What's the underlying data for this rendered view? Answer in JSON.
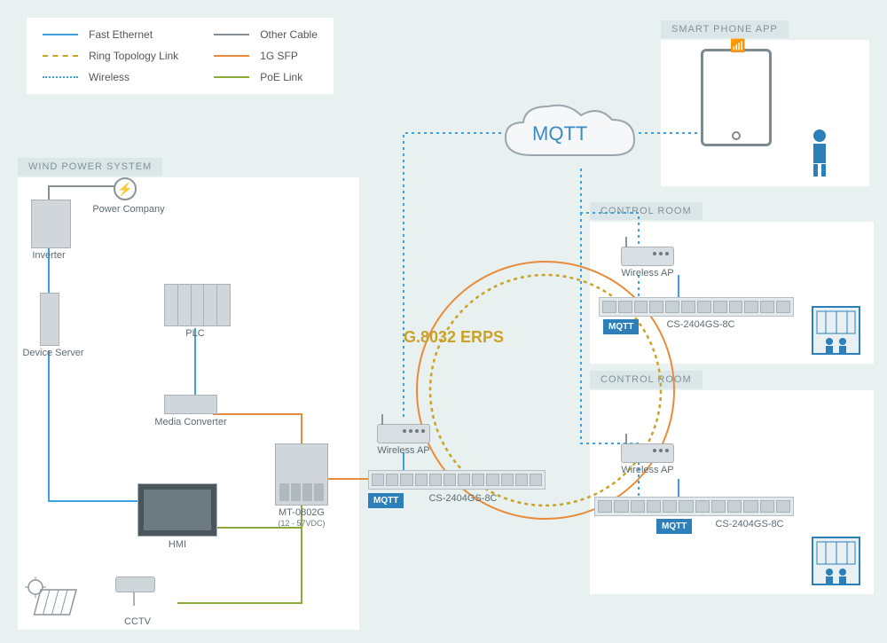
{
  "legend": {
    "col1": [
      {
        "label": "Fast Ethernet",
        "color": "#3aa2e0",
        "dash": "solid"
      },
      {
        "label": "Ring Topology Link",
        "color": "#c9a227",
        "dash": "dashed"
      },
      {
        "label": "Wireless",
        "color": "#3aa2e0",
        "dash": "dotted"
      }
    ],
    "col2": [
      {
        "label": "Other Cable",
        "color": "#888f94",
        "dash": "solid"
      },
      {
        "label": "1G SFP",
        "color": "#e88b3a",
        "dash": "solid"
      },
      {
        "label": "PoE Link",
        "color": "#8aaa3a",
        "dash": "solid"
      }
    ]
  },
  "panels": {
    "wind": "WIND POWER SYSTEM",
    "app": "SMART PHONE APP",
    "control1": "CONTROL ROOM",
    "control2": "CONTROL ROOM"
  },
  "nodes": {
    "inverter": "Inverter",
    "power_company": "Power Company",
    "device_server": "Device Server",
    "plc": "PLC",
    "media_converter": "Media Converter",
    "hmi": "HMI",
    "cctv": "CCTV",
    "mt0802g": "MT-0802G",
    "mt0802g_sub": "(12 - 57VDC)",
    "wireless_ap": "Wireless AP",
    "switch_model": "CS-2404GS-8C"
  },
  "badges": {
    "mqtt": "MQTT"
  },
  "labels": {
    "cloud": "MQTT",
    "erps": "G.8032 ERPS"
  },
  "colors": {
    "fast_eth": "#3aa2e0",
    "ring": "#c9a227",
    "wireless": "#3aa2e0",
    "other": "#888f94",
    "sfp": "#e88b3a",
    "poe": "#8aaa3a"
  }
}
